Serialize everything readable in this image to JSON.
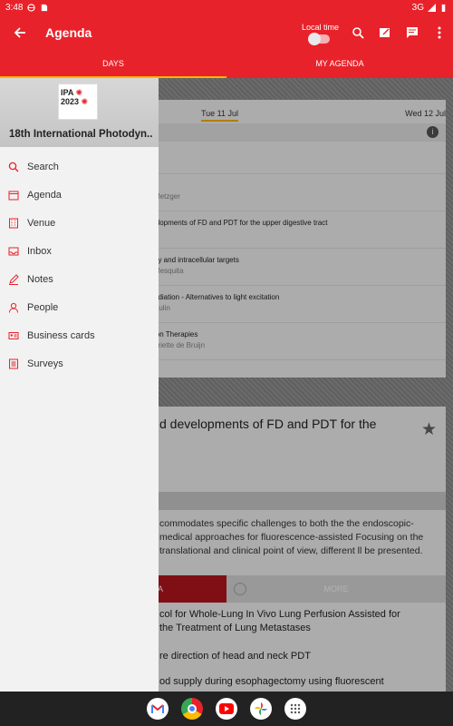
{
  "status": {
    "time": "3:48",
    "network": "3G"
  },
  "toolbar": {
    "title": "Agenda",
    "local_time_label": "Local time"
  },
  "tabs": [
    {
      "label": "DAYS",
      "active": true
    },
    {
      "label": "MY AGENDA",
      "active": false
    }
  ],
  "days": {
    "current": "Tue 11 Jul",
    "next": "Wed 12 Jul"
  },
  "sessions": [
    {
      "title": "n",
      "speaker": "Metzger"
    },
    {
      "title": "elopments of FD and PDT for the upper digestive tract",
      "speaker": ""
    },
    {
      "title": "gy and intracellular targets",
      "speaker": "Mesquita"
    },
    {
      "title": "adiation - Alternatives to light excitation",
      "speaker": "Bulin"
    },
    {
      "title": "ion Therapies",
      "speaker": "nriette de Bruijn"
    },
    {
      "title": "",
      "speaker": ""
    }
  ],
  "detail": {
    "title": "d developments of FD and PDT for the",
    "description": "commodates specific challenges to both the the endoscopic-medical approaches for fluorescence-assisted Focusing on the translational and clinical point of view, different ll be presented.",
    "button_left": "A",
    "button_more": "MORE",
    "talks": [
      "col for Whole-Lung In Vivo Lung Perfusion Assisted for the Treatment of Lung Metastases",
      "re direction of head and neck PDT",
      "od supply during esophagectomy using fluorescent"
    ]
  },
  "drawer": {
    "logo_text": "IPA",
    "logo_year": "2023",
    "conference": "18th International Photodyn..",
    "items": [
      {
        "label": "Search",
        "icon": "search-icon"
      },
      {
        "label": "Agenda",
        "icon": "agenda-icon"
      },
      {
        "label": "Venue",
        "icon": "venue-icon"
      },
      {
        "label": "Inbox",
        "icon": "inbox-icon"
      },
      {
        "label": "Notes",
        "icon": "notes-icon"
      },
      {
        "label": "People",
        "icon": "people-icon"
      },
      {
        "label": "Business cards",
        "icon": "business-cards-icon"
      },
      {
        "label": "Surveys",
        "icon": "surveys-icon"
      }
    ]
  },
  "colors": {
    "brand": "#e8222b",
    "accent": "#ffb300"
  },
  "nav_apps": [
    "gmail-icon",
    "chrome-icon",
    "youtube-icon",
    "photos-icon",
    "apps-icon"
  ]
}
